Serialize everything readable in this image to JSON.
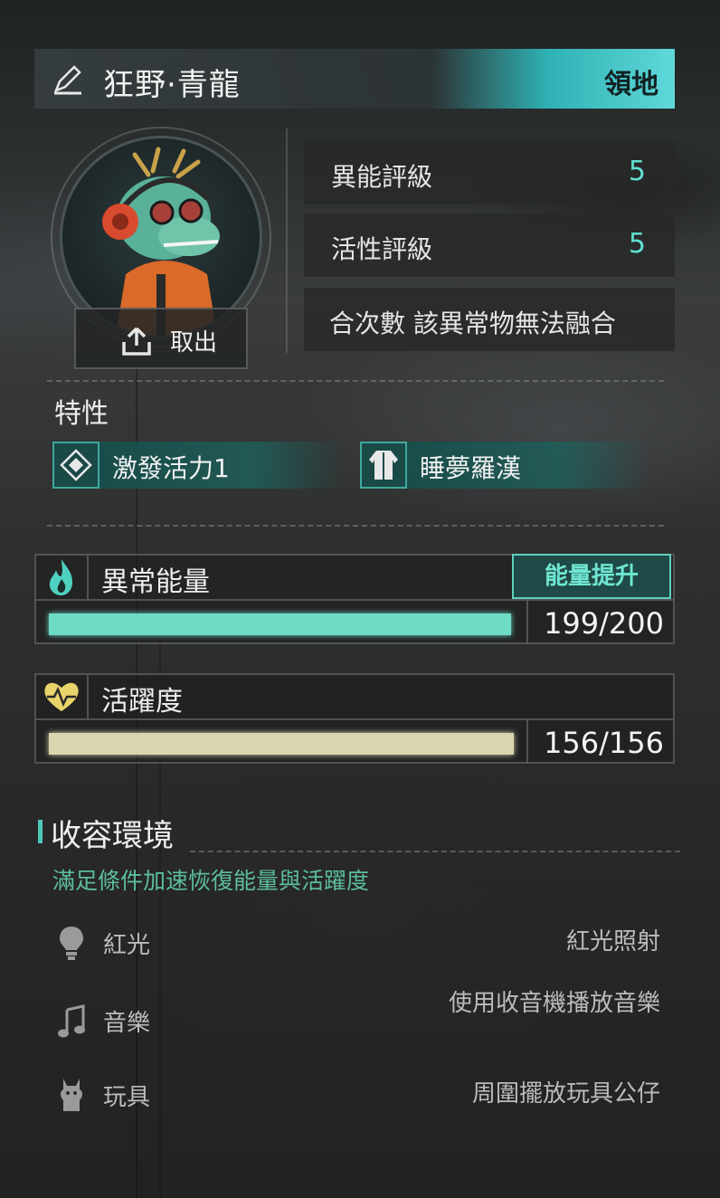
{
  "header": {
    "name": "狂野·青龍",
    "territory": "領地"
  },
  "portrait": {
    "takeout_label": "取出"
  },
  "stats": [
    {
      "label": "異能評級",
      "value": "5"
    },
    {
      "label": "活性評級",
      "value": "5"
    },
    {
      "label": "合次數 該異常物無法融合"
    }
  ],
  "traits": {
    "title": "特性",
    "items": [
      {
        "label": "激發活力1",
        "icon": "diamond-icon"
      },
      {
        "label": "睡夢羅漢",
        "icon": "robe-icon"
      }
    ]
  },
  "energy": {
    "title": "異常能量",
    "upgrade_label": "能量提升",
    "value": "199/200",
    "current": 199,
    "max": 200,
    "color": "#6fdcc8"
  },
  "vitality": {
    "title": "活躍度",
    "value": "156/156",
    "current": 156,
    "max": 156,
    "color": "#d9d5ae"
  },
  "environment": {
    "title": "收容環境",
    "subtitle": "滿足條件加速恢復能量與活躍度",
    "rows": [
      {
        "label": "紅光",
        "requirement": "紅光照射",
        "icon": "lightbulb-icon"
      },
      {
        "label": "音樂",
        "requirement": "使用收音機播放音樂",
        "icon": "music-note-icon"
      },
      {
        "label": "玩具",
        "requirement": "周圍擺放玩具公仔",
        "icon": "toy-llama-icon"
      }
    ]
  }
}
